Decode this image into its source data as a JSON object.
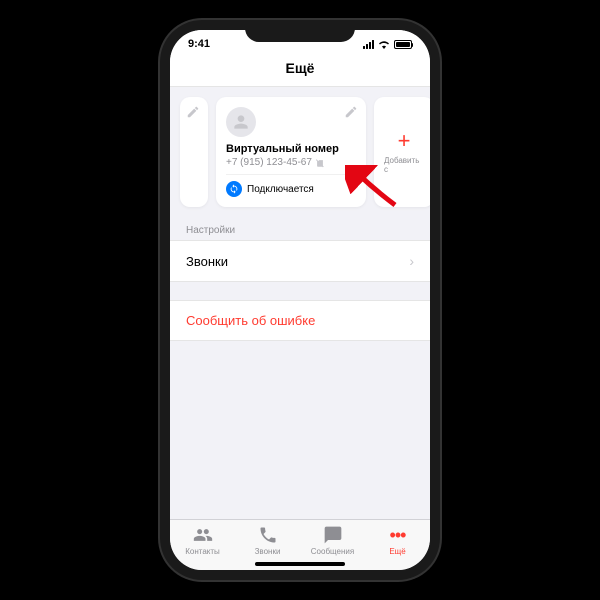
{
  "status_bar": {
    "time": "9:41"
  },
  "header": {
    "title": "Ещё"
  },
  "virtual_card": {
    "title": "Виртуальный номер",
    "phone": "+7 (915) 123-45-67",
    "status": "Подключается"
  },
  "add_card": {
    "label": "Добавить с"
  },
  "settings": {
    "section_label": "Настройки",
    "calls_label": "Звонки"
  },
  "report": {
    "label": "Сообщить об ошибке"
  },
  "tabs": {
    "contacts": "Контакты",
    "calls": "Звонки",
    "messages": "Сообщения",
    "more": "Ещё"
  }
}
